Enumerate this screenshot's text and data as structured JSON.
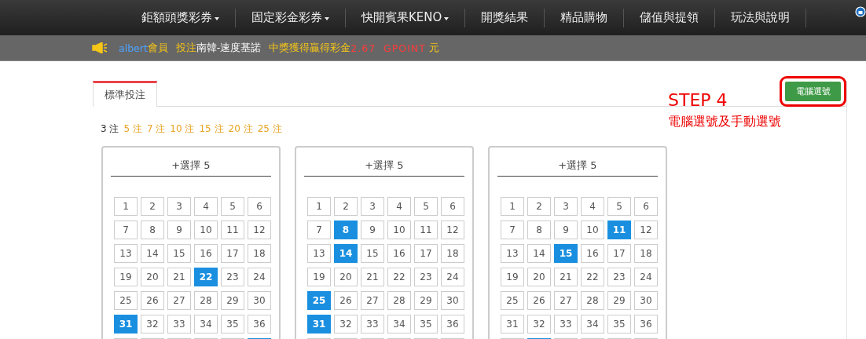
{
  "nav": {
    "items": [
      {
        "label": "鉅額頭獎彩券",
        "dropdown": true
      },
      {
        "label": "固定彩金彩券",
        "dropdown": true
      },
      {
        "label": "快開賓果KENO",
        "dropdown": true
      },
      {
        "label": "開獎結果",
        "dropdown": false
      },
      {
        "label": "精品購物",
        "dropdown": false
      },
      {
        "label": "儲值與提領",
        "dropdown": false
      },
      {
        "label": "玩法與說明",
        "dropdown": false
      }
    ]
  },
  "notice": {
    "user": "albert",
    "member": "會員",
    "bet_label": "投注",
    "game": "南韓-速度基諾",
    "prize_label": "中獎獲得贏得彩金",
    "amount": "2.67  GPOINT",
    "unit": "元"
  },
  "tabs": [
    {
      "label": "標準投注",
      "selected": true
    }
  ],
  "auto_pick_button": "電腦選號",
  "annotation": {
    "title": "STEP 4",
    "subtitle": "電腦選號及手動選號"
  },
  "bet_counts": [
    {
      "label": "3 注",
      "selected": true
    },
    {
      "label": "5 注",
      "selected": false
    },
    {
      "label": "7 注",
      "selected": false
    },
    {
      "label": "10 注",
      "selected": false
    },
    {
      "label": "15 注",
      "selected": false
    },
    {
      "label": "20 注",
      "selected": false
    },
    {
      "label": "25 注",
      "selected": false
    }
  ],
  "cards": [
    {
      "title": "+選擇 5",
      "numbers": [
        {
          "label": "1",
          "selected": false
        },
        {
          "label": "2",
          "selected": false
        },
        {
          "label": "3",
          "selected": false
        },
        {
          "label": "4",
          "selected": false
        },
        {
          "label": "5",
          "selected": false
        },
        {
          "label": "6",
          "selected": false
        },
        {
          "label": "7",
          "selected": false
        },
        {
          "label": "8",
          "selected": false
        },
        {
          "label": "9",
          "selected": false
        },
        {
          "label": "10",
          "selected": false
        },
        {
          "label": "11",
          "selected": false
        },
        {
          "label": "12",
          "selected": false
        },
        {
          "label": "13",
          "selected": false
        },
        {
          "label": "14",
          "selected": false
        },
        {
          "label": "15",
          "selected": false
        },
        {
          "label": "16",
          "selected": false
        },
        {
          "label": "17",
          "selected": false
        },
        {
          "label": "18",
          "selected": false
        },
        {
          "label": "19",
          "selected": false
        },
        {
          "label": "20",
          "selected": false
        },
        {
          "label": "21",
          "selected": false
        },
        {
          "label": "22",
          "selected": true
        },
        {
          "label": "23",
          "selected": false
        },
        {
          "label": "24",
          "selected": false
        },
        {
          "label": "25",
          "selected": false
        },
        {
          "label": "26",
          "selected": false
        },
        {
          "label": "27",
          "selected": false
        },
        {
          "label": "28",
          "selected": false
        },
        {
          "label": "29",
          "selected": false
        },
        {
          "label": "30",
          "selected": false
        },
        {
          "label": "31",
          "selected": true
        },
        {
          "label": "32",
          "selected": false
        },
        {
          "label": "33",
          "selected": false
        },
        {
          "label": "34",
          "selected": false
        },
        {
          "label": "35",
          "selected": false
        },
        {
          "label": "36",
          "selected": false
        }
      ],
      "cut_row": [
        false,
        false,
        false,
        false,
        false,
        true
      ]
    },
    {
      "title": "+選擇 5",
      "numbers": [
        {
          "label": "1",
          "selected": false
        },
        {
          "label": "2",
          "selected": false
        },
        {
          "label": "3",
          "selected": false
        },
        {
          "label": "4",
          "selected": false
        },
        {
          "label": "5",
          "selected": false
        },
        {
          "label": "6",
          "selected": false
        },
        {
          "label": "7",
          "selected": false
        },
        {
          "label": "8",
          "selected": true
        },
        {
          "label": "9",
          "selected": false
        },
        {
          "label": "10",
          "selected": false
        },
        {
          "label": "11",
          "selected": false
        },
        {
          "label": "12",
          "selected": false
        },
        {
          "label": "13",
          "selected": false
        },
        {
          "label": "14",
          "selected": true
        },
        {
          "label": "15",
          "selected": false
        },
        {
          "label": "16",
          "selected": false
        },
        {
          "label": "17",
          "selected": false
        },
        {
          "label": "18",
          "selected": false
        },
        {
          "label": "19",
          "selected": false
        },
        {
          "label": "20",
          "selected": false
        },
        {
          "label": "21",
          "selected": false
        },
        {
          "label": "22",
          "selected": false
        },
        {
          "label": "23",
          "selected": false
        },
        {
          "label": "24",
          "selected": false
        },
        {
          "label": "25",
          "selected": true
        },
        {
          "label": "26",
          "selected": false
        },
        {
          "label": "27",
          "selected": false
        },
        {
          "label": "28",
          "selected": false
        },
        {
          "label": "29",
          "selected": false
        },
        {
          "label": "30",
          "selected": false
        },
        {
          "label": "31",
          "selected": true
        },
        {
          "label": "32",
          "selected": false
        },
        {
          "label": "33",
          "selected": false
        },
        {
          "label": "34",
          "selected": false
        },
        {
          "label": "35",
          "selected": false
        },
        {
          "label": "36",
          "selected": false
        }
      ],
      "cut_row": [
        false,
        false,
        false,
        false,
        false,
        false
      ]
    },
    {
      "title": "+選擇 5",
      "numbers": [
        {
          "label": "1",
          "selected": false
        },
        {
          "label": "2",
          "selected": false
        },
        {
          "label": "3",
          "selected": false
        },
        {
          "label": "4",
          "selected": false
        },
        {
          "label": "5",
          "selected": false
        },
        {
          "label": "6",
          "selected": false
        },
        {
          "label": "7",
          "selected": false
        },
        {
          "label": "8",
          "selected": false
        },
        {
          "label": "9",
          "selected": false
        },
        {
          "label": "10",
          "selected": false
        },
        {
          "label": "11",
          "selected": true
        },
        {
          "label": "12",
          "selected": false
        },
        {
          "label": "13",
          "selected": false
        },
        {
          "label": "14",
          "selected": false
        },
        {
          "label": "15",
          "selected": true
        },
        {
          "label": "16",
          "selected": false
        },
        {
          "label": "17",
          "selected": false
        },
        {
          "label": "18",
          "selected": false
        },
        {
          "label": "19",
          "selected": false
        },
        {
          "label": "20",
          "selected": false
        },
        {
          "label": "21",
          "selected": false
        },
        {
          "label": "22",
          "selected": false
        },
        {
          "label": "23",
          "selected": false
        },
        {
          "label": "24",
          "selected": false
        },
        {
          "label": "25",
          "selected": false
        },
        {
          "label": "26",
          "selected": false
        },
        {
          "label": "27",
          "selected": false
        },
        {
          "label": "28",
          "selected": false
        },
        {
          "label": "29",
          "selected": false
        },
        {
          "label": "30",
          "selected": false
        },
        {
          "label": "31",
          "selected": false
        },
        {
          "label": "32",
          "selected": false
        },
        {
          "label": "33",
          "selected": false
        },
        {
          "label": "34",
          "selected": false
        },
        {
          "label": "35",
          "selected": false
        },
        {
          "label": "36",
          "selected": false
        }
      ],
      "cut_row": [
        false,
        true,
        false,
        false,
        false,
        false
      ]
    }
  ]
}
